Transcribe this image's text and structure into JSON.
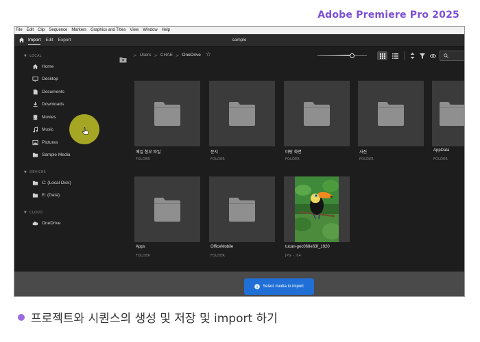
{
  "slide": {
    "title": "Adobe Premiere Pro 2025",
    "caption": "프로젝트와 시퀀스의 생성 및 저장 및 import 하기"
  },
  "menu": [
    "File",
    "Edit",
    "Clip",
    "Sequence",
    "Markers",
    "Graphics and Titles",
    "View",
    "Window",
    "Help"
  ],
  "appbar": {
    "tabs": [
      {
        "label": "Import",
        "active": true
      },
      {
        "label": "Edit",
        "active": false
      },
      {
        "label": "Export",
        "active": false
      }
    ],
    "project_name": "sample"
  },
  "sidebar": {
    "local_label": "LOCAL",
    "local": [
      {
        "label": "Home",
        "icon": "home-icon"
      },
      {
        "label": "Desktop",
        "icon": "monitor-icon"
      },
      {
        "label": "Documents",
        "icon": "document-icon"
      },
      {
        "label": "Downloads",
        "icon": "download-icon"
      },
      {
        "label": "Movies",
        "icon": "film-icon"
      },
      {
        "label": "Music",
        "icon": "music-icon"
      },
      {
        "label": "Pictures",
        "icon": "image-icon"
      },
      {
        "label": "Sample Media",
        "icon": "folder-icon"
      }
    ],
    "devices_label": "DEVICES",
    "devices": [
      {
        "label": "C: (Local Disk)",
        "icon": "folder-icon"
      },
      {
        "label": "E: (Data)",
        "icon": "folder-icon"
      }
    ],
    "cloud_label": "CLOUD",
    "cloud": [
      {
        "label": "OneDrive",
        "icon": "cloud-icon"
      }
    ]
  },
  "breadcrumb": [
    "Users",
    "CHAE",
    "OneDrive"
  ],
  "files": [
    {
      "name": "메일 첨부 파일",
      "type": "FOLDER",
      "kind": "folder"
    },
    {
      "name": "문서",
      "type": "FOLDER",
      "kind": "folder"
    },
    {
      "name": "바탕 화면",
      "type": "FOLDER",
      "kind": "folder"
    },
    {
      "name": "사진",
      "type": "FOLDER",
      "kind": "folder"
    },
    {
      "name": "AppData",
      "type": "FOLDER",
      "kind": "folder"
    },
    {
      "name": "Apps",
      "type": "FOLDER",
      "kind": "folder"
    },
    {
      "name": "OfficeMobile",
      "type": "FOLDER",
      "kind": "folder"
    },
    {
      "name": "tucan-gec068e63f_1920",
      "type": "JPG - .04",
      "kind": "image"
    }
  ],
  "import_button": {
    "label": "Select media to import"
  },
  "colors": {
    "accent": "#1f6fd6",
    "title": "#7b4fd6",
    "bullet": "#9a6be0",
    "highlight": "#cdcd28"
  }
}
